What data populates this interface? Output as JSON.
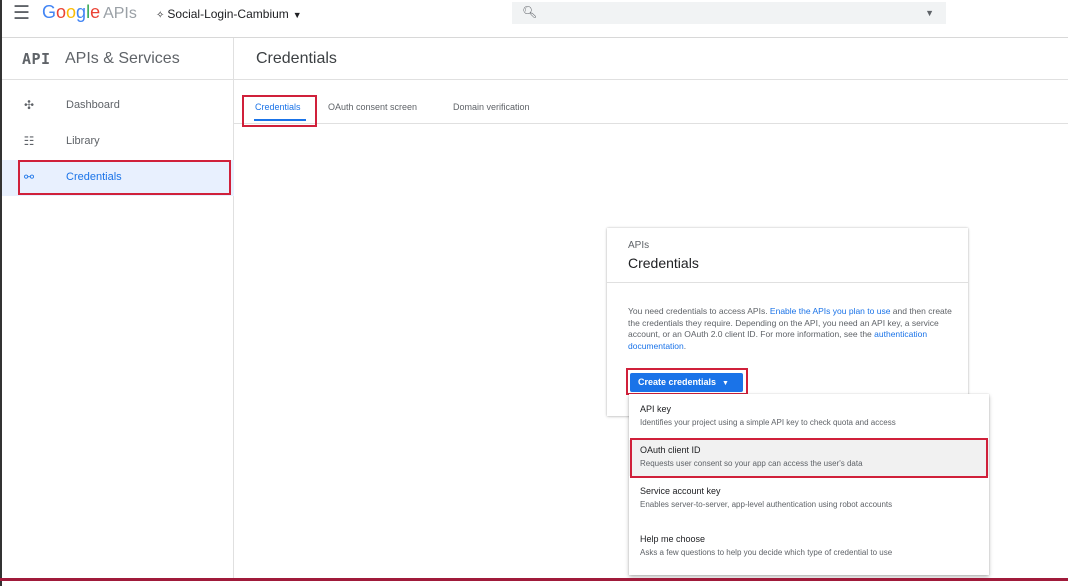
{
  "header": {
    "brand_parts": [
      "G",
      "o",
      "o",
      "g",
      "l",
      "e"
    ],
    "brand_suffix": "APIs",
    "project_name": "Social-Login-Cambium",
    "search_placeholder": ""
  },
  "sidebar": {
    "logo": "API",
    "title": "APIs & Services",
    "items": [
      {
        "label": "Dashboard",
        "icon": "dashboard-icon",
        "active": false
      },
      {
        "label": "Library",
        "icon": "library-icon",
        "active": false
      },
      {
        "label": "Credentials",
        "icon": "key-icon",
        "active": true
      }
    ]
  },
  "main": {
    "title": "Credentials",
    "tabs": [
      {
        "label": "Credentials",
        "active": true
      },
      {
        "label": "OAuth consent screen",
        "active": false
      },
      {
        "label": "Domain verification",
        "active": false
      }
    ]
  },
  "card": {
    "kicker": "APIs",
    "title": "Credentials",
    "text_1": "You need credentials to access APIs. ",
    "link_1": "Enable the APIs you plan to use",
    "text_2": " and then create the credentials they require. Depending on the API, you need an API key, a service account, or an OAuth 2.0 client ID. For more information, see the ",
    "link_2": "authentication documentation",
    "text_3": ".",
    "button_label": "Create credentials"
  },
  "menu": {
    "items": [
      {
        "title": "API key",
        "desc": "Identifies your project using a simple API key to check quota and access"
      },
      {
        "title": "OAuth client ID",
        "desc": "Requests user consent so your app can access the user's data"
      },
      {
        "title": "Service account key",
        "desc": "Enables server-to-server, app-level authentication using robot accounts"
      },
      {
        "title": "Help me choose",
        "desc": "Asks a few questions to help you decide which type of credential to use"
      }
    ]
  },
  "colors": {
    "accent": "#1a73e8",
    "highlight": "#d0203a"
  }
}
